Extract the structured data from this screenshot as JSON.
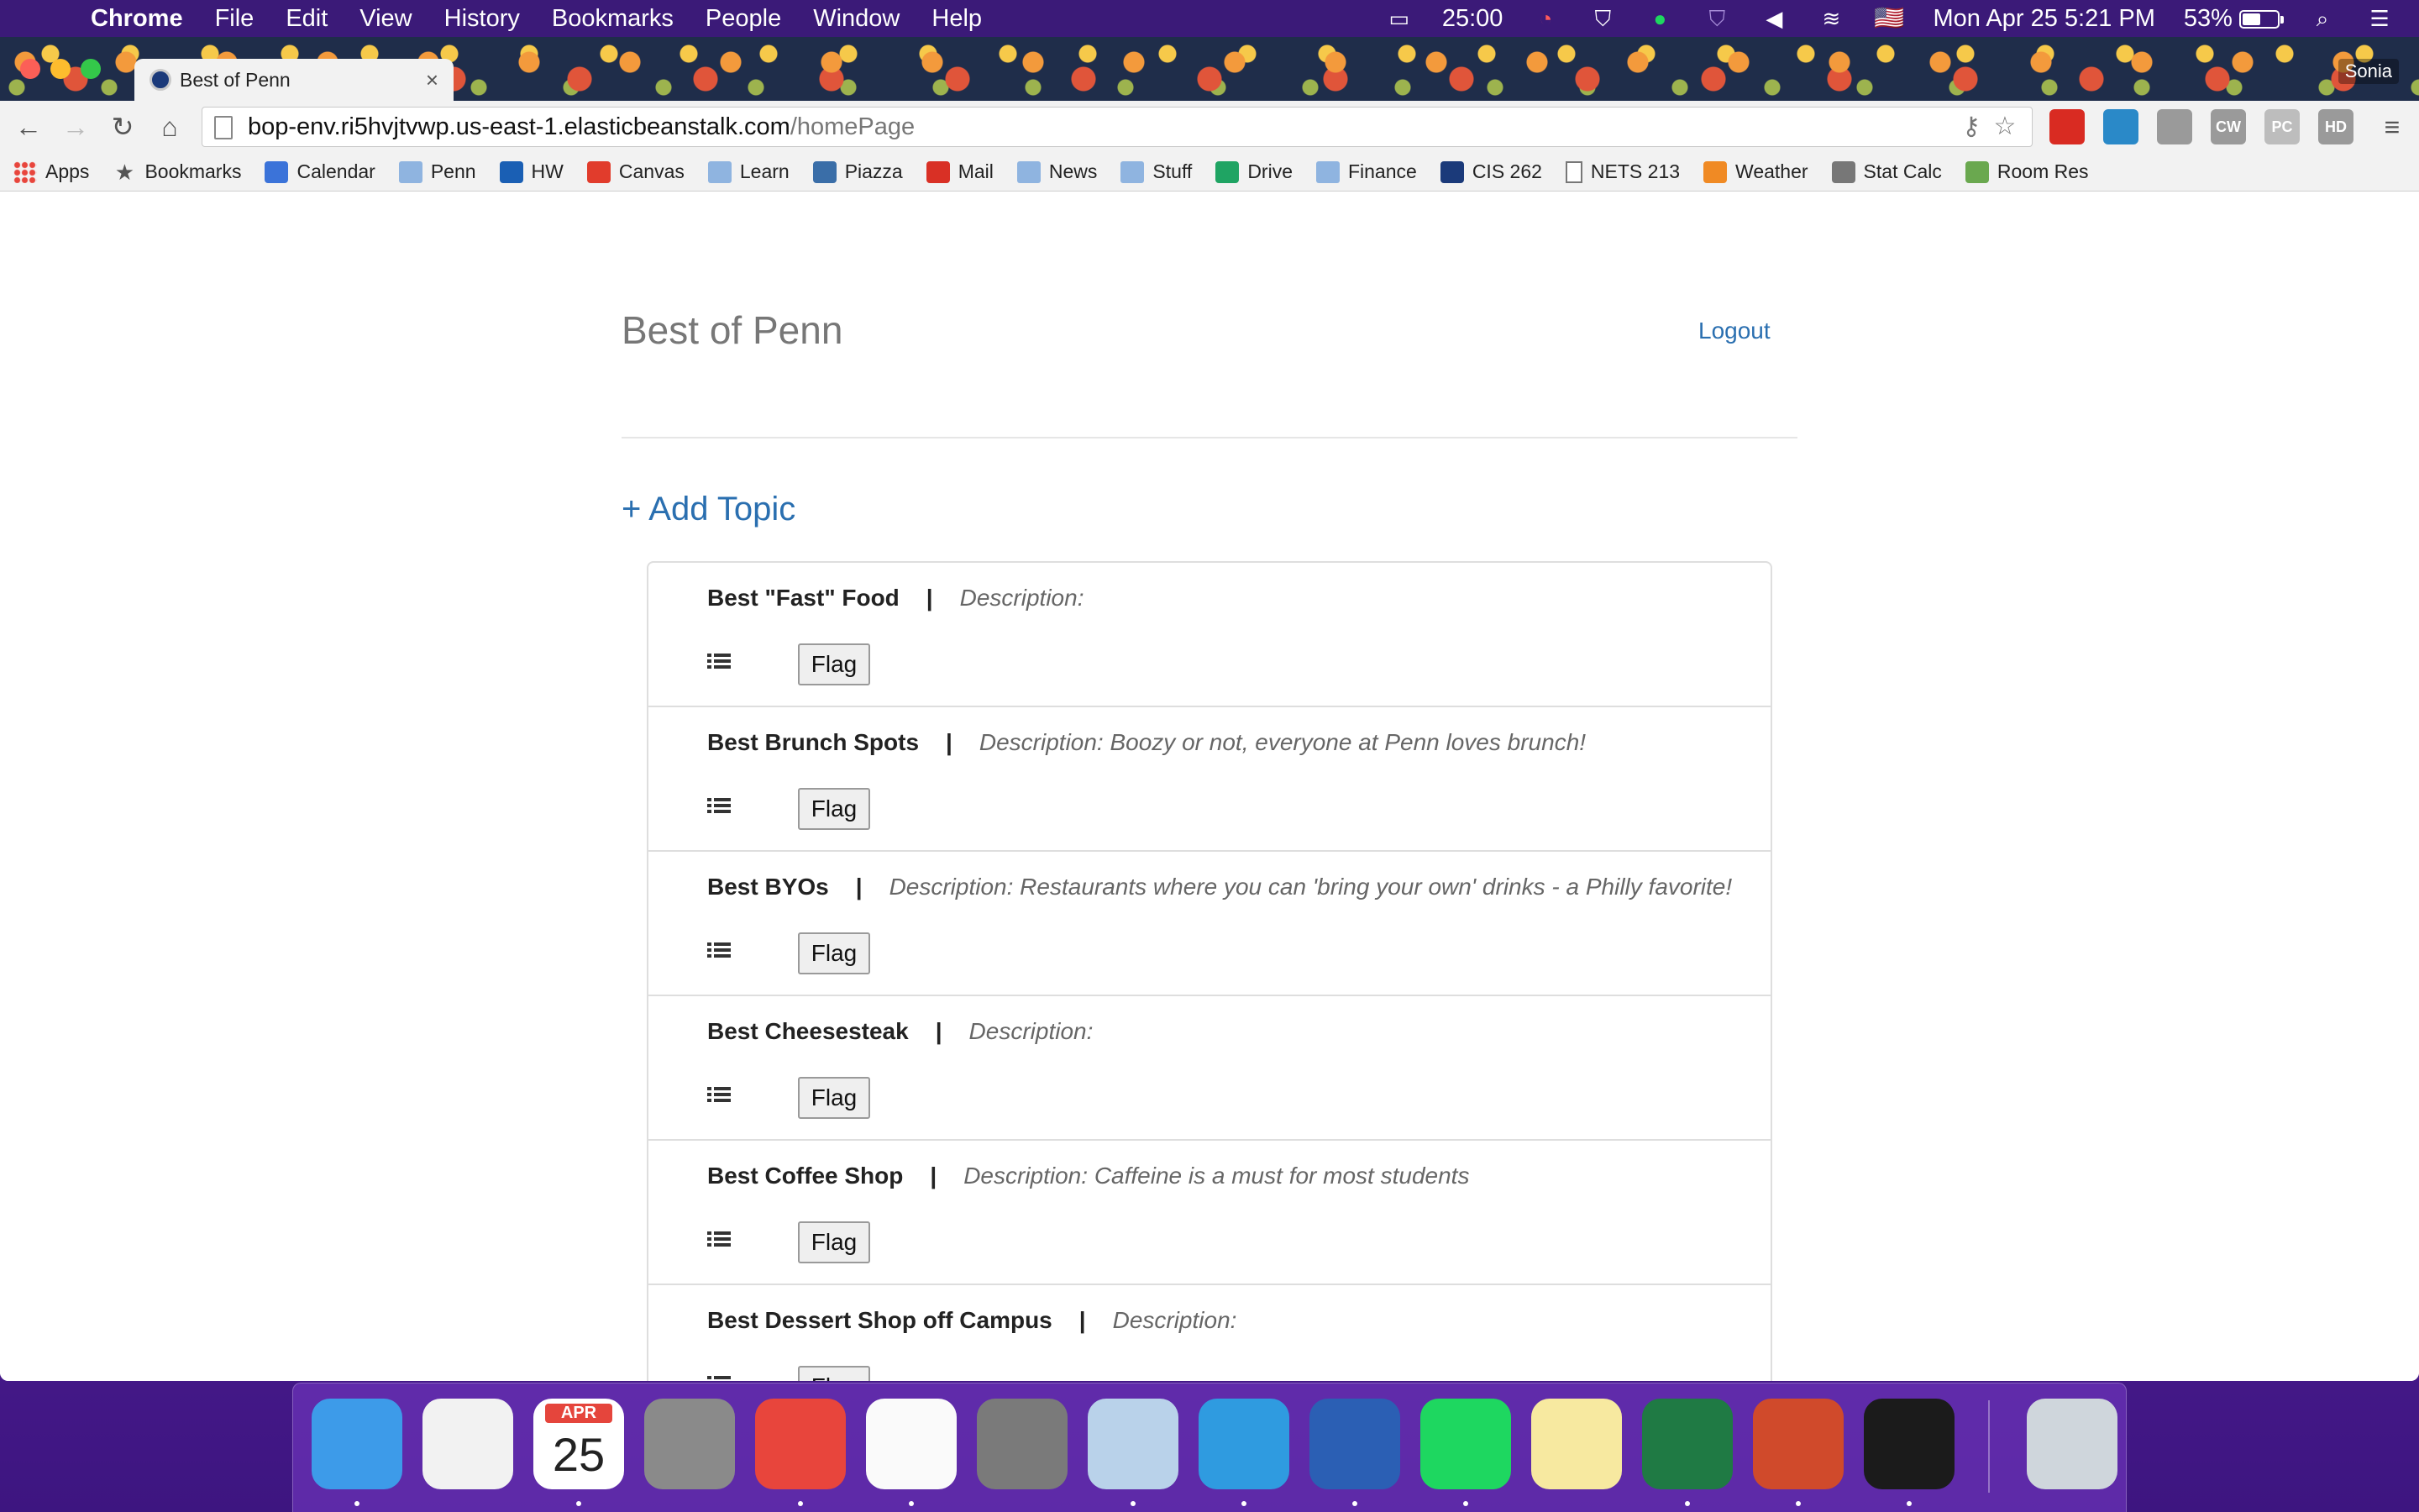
{
  "menubar": {
    "app_name": "Chrome",
    "items": [
      "File",
      "Edit",
      "View",
      "History",
      "Bookmarks",
      "People",
      "Window",
      "Help"
    ],
    "timer": "25:00",
    "input_flag": "🇺🇸",
    "datetime": "Mon Apr 25  5:21 PM",
    "battery_percent": "53%",
    "battery_level": 0.53
  },
  "browser": {
    "tab_title": "Best of Penn",
    "profile_name": "Sonia",
    "url_host": "bop-env.ri5hvjtvwp.us-east-1.elasticbeanstalk.com",
    "url_path": "/homePage",
    "bookmarks": [
      {
        "label": "Apps",
        "icon": "apps-grid-icon"
      },
      {
        "label": "Bookmarks",
        "icon": "star-icon"
      },
      {
        "label": "Calendar",
        "icon": "calendar-icon"
      },
      {
        "label": "Penn",
        "icon": "folder-icon"
      },
      {
        "label": "HW",
        "icon": "hw-icon"
      },
      {
        "label": "Canvas",
        "icon": "canvas-icon"
      },
      {
        "label": "Learn",
        "icon": "folder-icon"
      },
      {
        "label": "Piazza",
        "icon": "piazza-icon"
      },
      {
        "label": "Mail",
        "icon": "gmail-icon"
      },
      {
        "label": "News",
        "icon": "folder-icon"
      },
      {
        "label": "Stuff",
        "icon": "folder-icon"
      },
      {
        "label": "Drive",
        "icon": "drive-icon"
      },
      {
        "label": "Finance",
        "icon": "folder-icon"
      },
      {
        "label": "CIS 262",
        "icon": "penn-shield-icon"
      },
      {
        "label": "NETS 213",
        "icon": "page-icon"
      },
      {
        "label": "Weather",
        "icon": "weather-icon"
      },
      {
        "label": "Stat Calc",
        "icon": "calculator-icon"
      },
      {
        "label": "Room Res",
        "icon": "room-res-icon"
      }
    ],
    "extensions": [
      {
        "name": "adblock-icon",
        "color": "#d92b22",
        "text": ""
      },
      {
        "name": "eye-extension-icon",
        "color": "#2a89c8",
        "text": ""
      },
      {
        "name": "cast-extension-icon",
        "color": "#9a9a9a",
        "text": ""
      },
      {
        "name": "cw-extension-icon",
        "color": "#9a9a9a",
        "text": "CW"
      },
      {
        "name": "pc-extension-icon",
        "color": "#bdbdbd",
        "text": "PC"
      },
      {
        "name": "hd-extension-icon",
        "color": "#9a9a9a",
        "text": "HD"
      }
    ]
  },
  "page": {
    "site_title": "Best of Penn",
    "logout_label": "Logout",
    "add_topic_label": "+ Add Topic",
    "flag_label": "Flag",
    "separator": "|",
    "topics": [
      {
        "name": "Best \"Fast\" Food",
        "description": "Description:"
      },
      {
        "name": "Best Brunch Spots",
        "description": "Description: Boozy or not, everyone at Penn loves brunch!"
      },
      {
        "name": "Best BYOs",
        "description": "Description: Restaurants where you can 'bring your own' drinks - a Philly favorite!"
      },
      {
        "name": "Best Cheesesteak",
        "description": "Description:"
      },
      {
        "name": "Best Coffee Shop",
        "description": "Description: Caffeine is a must for most students"
      },
      {
        "name": "Best Dessert Shop off Campus",
        "description": "Description:"
      }
    ]
  },
  "dock": {
    "calendar_month": "APR",
    "calendar_day": "25",
    "apps": [
      {
        "name": "finder-icon",
        "color": "#3d9be9",
        "running": true
      },
      {
        "name": "itunes-icon",
        "color": "#f2f2f2",
        "running": false
      },
      {
        "name": "calendar-app-icon",
        "color": "#ffffff",
        "running": true
      },
      {
        "name": "launchpad-icon",
        "color": "#8a8a8a",
        "running": false
      },
      {
        "name": "chrome-icon",
        "color": "#e8453c",
        "running": true
      },
      {
        "name": "reminders-icon",
        "color": "#fafafa",
        "running": true
      },
      {
        "name": "system-preferences-icon",
        "color": "#7a7a7a",
        "running": false
      },
      {
        "name": "preview-icon",
        "color": "#b9d2ea",
        "running": true
      },
      {
        "name": "sketchbook-icon",
        "color": "#2f9be0",
        "running": true
      },
      {
        "name": "word-icon",
        "color": "#2b5fb4",
        "running": true
      },
      {
        "name": "spotify-icon",
        "color": "#1ed760",
        "running": true
      },
      {
        "name": "notes-icon",
        "color": "#f7e9a0",
        "running": false
      },
      {
        "name": "excel-icon",
        "color": "#1f7a44",
        "running": true
      },
      {
        "name": "powerpoint-icon",
        "color": "#d04a2b",
        "running": true
      },
      {
        "name": "terminal-icon",
        "color": "#1b1b1b",
        "running": true
      },
      {
        "name": "trash-icon",
        "color": "#cfd6dc",
        "running": false
      }
    ]
  }
}
